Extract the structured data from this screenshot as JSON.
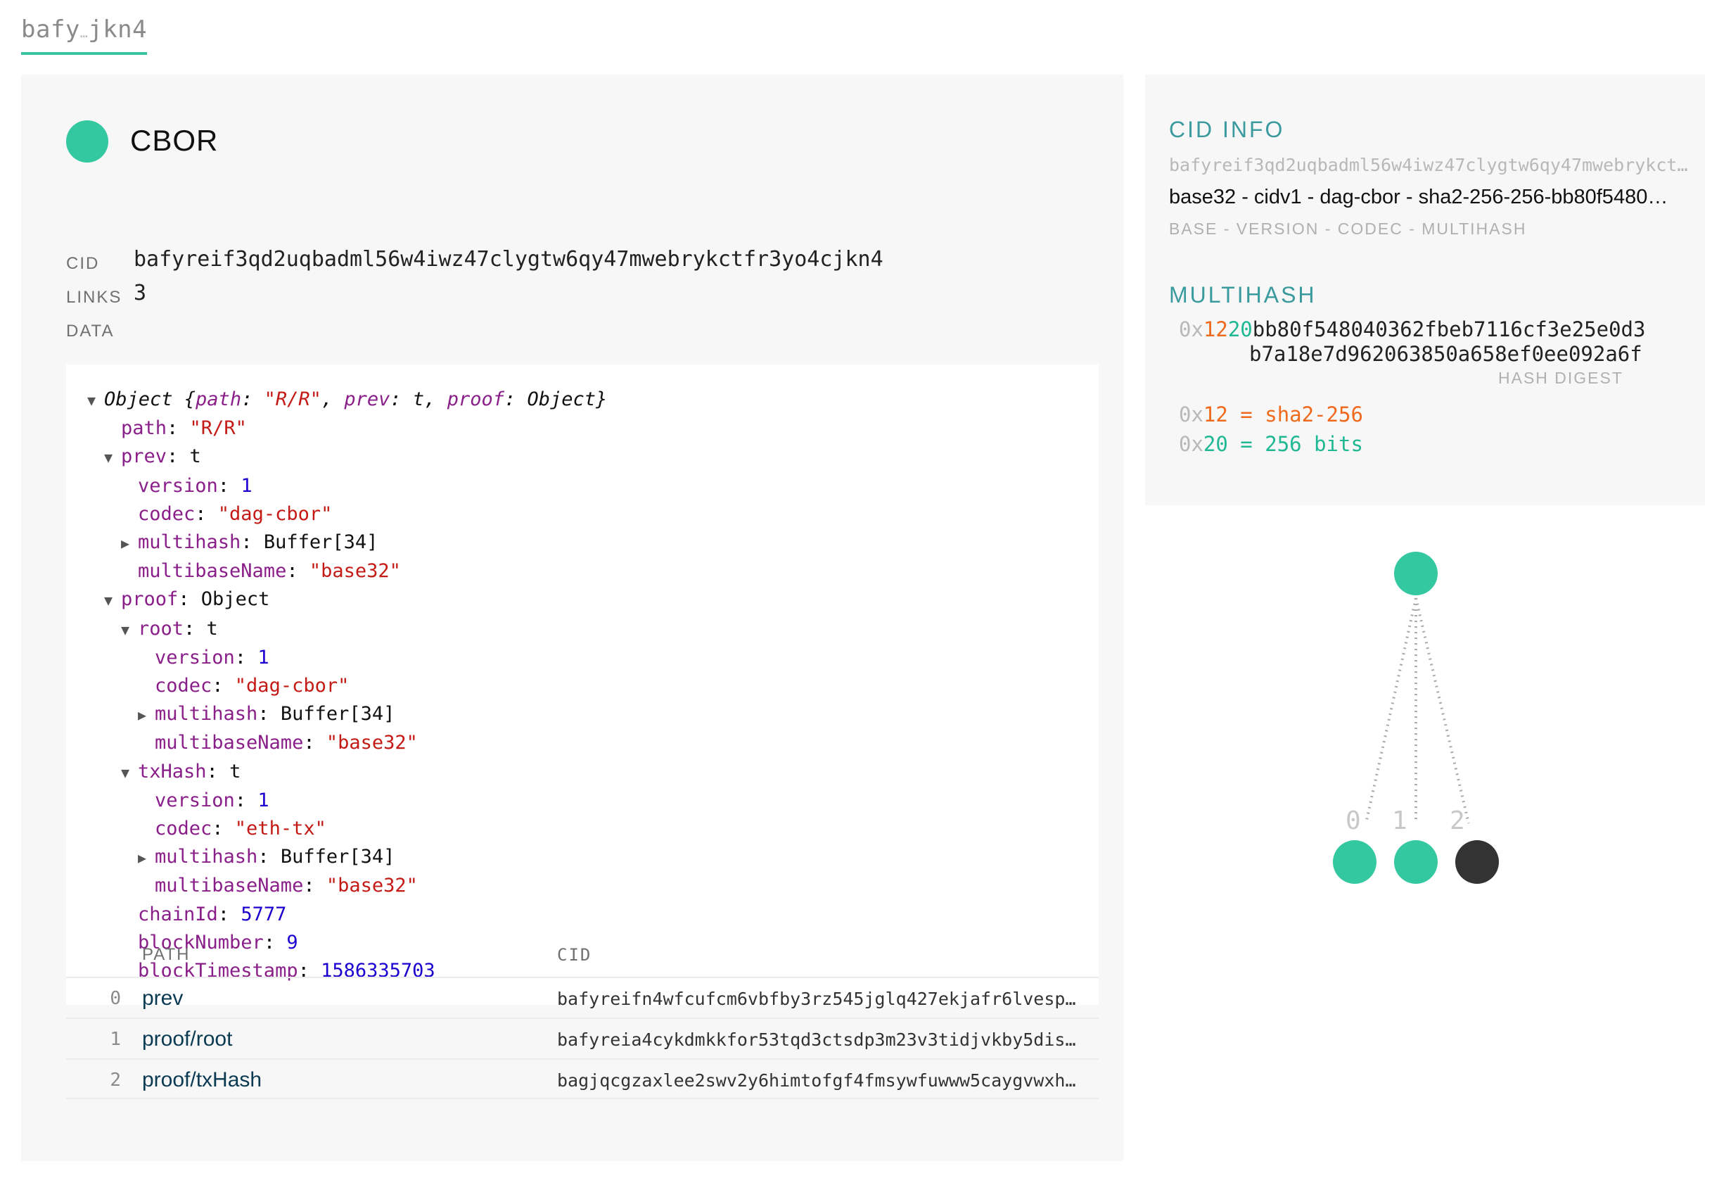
{
  "breadcrumb": {
    "start": "bafy",
    "ellipsis": "…",
    "end": "jkn4"
  },
  "node": {
    "type": "CBOR",
    "cid_label": "CID",
    "cid": "bafyreif3qd2uqbadml56w4iwz47clygtw6qy47mwebrykctfr3yo4cjkn4",
    "links_label": "LINKS",
    "links": "3",
    "data_label": "DATA"
  },
  "data_tree": {
    "header": {
      "key1": "path",
      "val1": "\"R/R\"",
      "key2": "prev",
      "val2": "t",
      "key3": "proof",
      "val3": "Object",
      "prefix": "Object {",
      "suffix": "}"
    },
    "lines": [
      {
        "key": "path",
        "value": "\"R/R\"",
        "kind": "s"
      },
      {
        "key": "prev",
        "value": "t",
        "kind": "plain"
      },
      {
        "key": "version",
        "value": "1",
        "kind": "n"
      },
      {
        "key": "codec",
        "value": "\"dag-cbor\"",
        "kind": "s"
      },
      {
        "key": "multihash",
        "value": "Buffer[34]",
        "kind": "plain"
      },
      {
        "key": "multibaseName",
        "value": "\"base32\"",
        "kind": "s"
      },
      {
        "key": "proof",
        "value": "Object",
        "kind": "plain"
      },
      {
        "key": "root",
        "value": "t",
        "kind": "plain"
      },
      {
        "key": "version",
        "value": "1",
        "kind": "n"
      },
      {
        "key": "codec",
        "value": "\"dag-cbor\"",
        "kind": "s"
      },
      {
        "key": "multihash",
        "value": "Buffer[34]",
        "kind": "plain"
      },
      {
        "key": "multibaseName",
        "value": "\"base32\"",
        "kind": "s"
      },
      {
        "key": "txHash",
        "value": "t",
        "kind": "plain"
      },
      {
        "key": "version",
        "value": "1",
        "kind": "n"
      },
      {
        "key": "codec",
        "value": "\"eth-tx\"",
        "kind": "s"
      },
      {
        "key": "multihash",
        "value": "Buffer[34]",
        "kind": "plain"
      },
      {
        "key": "multibaseName",
        "value": "\"base32\"",
        "kind": "s"
      },
      {
        "key": "chainId",
        "value": "5777",
        "kind": "n"
      },
      {
        "key": "blockNumber",
        "value": "9",
        "kind": "n"
      },
      {
        "key": "blockTimestamp",
        "value": "1586335703",
        "kind": "n"
      }
    ]
  },
  "links_table": {
    "path_header": "PATH",
    "cid_header": "CID",
    "rows": [
      {
        "index": "0",
        "path": "prev",
        "cid": "bafyreifn4wfcufcm6vbfby3rz545jglq427ekjafr6lvesp…"
      },
      {
        "index": "1",
        "path": "proof/root",
        "cid": "bafyreia4cykdmkkfor53tqd3ctsdp3m23v3tidjvkby5dis…"
      },
      {
        "index": "2",
        "path": "proof/txHash",
        "cid": "bagjqcgzaxlee2swv2y6himtofgf4fmsywfuwww5caygvwxh…"
      }
    ]
  },
  "cid_info": {
    "title": "CID INFO",
    "cid": "bafyreif3qd2uqbadml56w4iwz47clygtw6qy47mwebrykctf…",
    "parts": "base32 - cidv1 - dag-cbor - sha2-256-256-bb80f5480…",
    "legend": "BASE - VERSION - CODEC - MULTIHASH"
  },
  "multihash": {
    "title": "MULTIHASH",
    "prefix": "0x",
    "code": "12",
    "length": "20",
    "digest_line1": "bb80f548040362fbeb7116cf3e25e0d3",
    "digest_line2": "b7a18e7d962063850a658ef0ee092a6f",
    "digest_label": "HASH DIGEST",
    "code_prefix": "0x",
    "code_value": "12",
    "code_equals": " = ",
    "code_name": "sha2-256",
    "len_prefix": "0x",
    "len_value": "20",
    "len_equals": " = ",
    "len_name": "256 bits"
  },
  "graph": {
    "child_labels": [
      "0",
      "1",
      "2"
    ],
    "node_color": "#34c8a0",
    "unresolved_color": "#333333"
  },
  "colors": {
    "accent": "#34c8a0",
    "teal_title": "#3b9a9e",
    "orange": "#f06a1e"
  }
}
